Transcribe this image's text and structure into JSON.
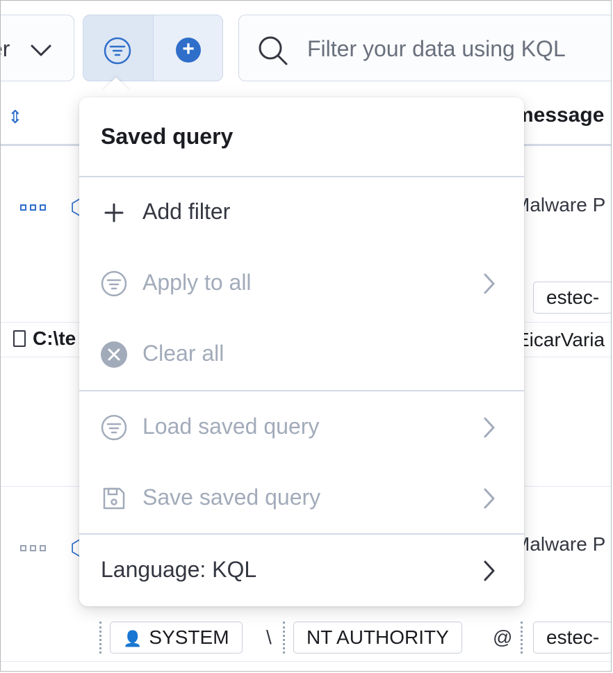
{
  "toolbar": {
    "combo_text": "er",
    "search_placeholder": "Filter your data using KQL"
  },
  "table": {
    "message_header": "message",
    "rows": [
      {
        "message": "Malware P"
      },
      {
        "path": "C:\\te",
        "message": "EicarVaria",
        "host_badge": "estec-"
      },
      {
        "message": "Malware P",
        "user": "SYSTEM",
        "separator": "\\",
        "domain": "NT AUTHORITY",
        "at": "@",
        "host_badge": "estec-"
      }
    ]
  },
  "popover": {
    "title": "Saved query",
    "items": [
      {
        "label": "Add filter",
        "icon": "plus-icon",
        "enabled": true
      },
      {
        "label": "Apply to all",
        "icon": "filter-icon",
        "enabled": false,
        "submenu": true
      },
      {
        "label": "Clear all",
        "icon": "clear-icon",
        "enabled": false
      },
      {
        "label": "Load saved query",
        "icon": "filter-icon",
        "enabled": false,
        "submenu": true
      },
      {
        "label": "Save saved query",
        "icon": "save-icon",
        "enabled": false,
        "submenu": true
      },
      {
        "label": "Language: KQL",
        "icon": "",
        "enabled": true,
        "submenu": true
      }
    ]
  },
  "colors": {
    "accent": "#2f6fca",
    "disabled_text": "#a2abba",
    "text": "#343741"
  }
}
